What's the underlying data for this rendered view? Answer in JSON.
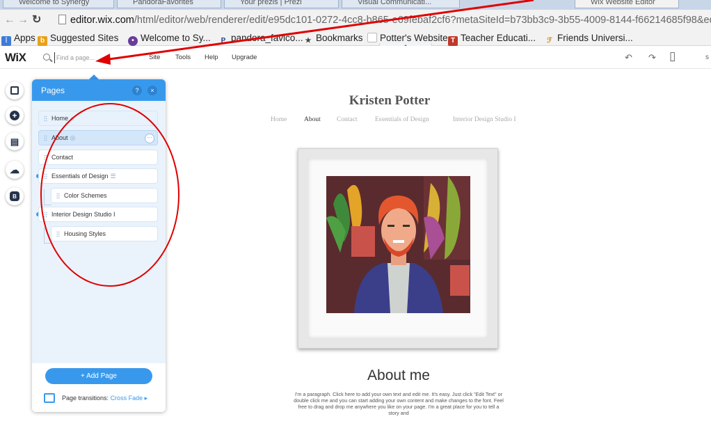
{
  "browser": {
    "tabs": [
      {
        "label": "Welcome to Synergy"
      },
      {
        "label": "PandoraFavorites"
      },
      {
        "label": "Your prezis | Prezi"
      },
      {
        "label": "Visual Communicati..."
      },
      {
        "label": "Wix Website Editor"
      }
    ],
    "url_host": "editor.wix.com",
    "url_path": "/html/editor/web/renderer/edit/e95dc101-0272-4cc8-b865-e69febaf2cf6?metaSiteId=b73bb3c9-3b55-4009-8144-f66214685f98&editorSe",
    "bookmarks": [
      {
        "label": "Apps",
        "icon": "apps-grid-icon",
        "color": "#3d7bd8"
      },
      {
        "label": "Suggested Sites",
        "icon": "suggested-sites-icon",
        "color": "#e8a11a"
      },
      {
        "label": "Welcome to Sy...",
        "icon": "synergy-icon",
        "color": "#6a3d9a"
      },
      {
        "label": "pandora_favico...",
        "icon": "pandora-icon",
        "color": "#224488"
      },
      {
        "label": "Bookmarks",
        "icon": "star-icon",
        "color": "#444444"
      },
      {
        "label": "Potter's Website",
        "icon": "document-icon",
        "color": "#bbbbbb"
      },
      {
        "label": "Teacher Educati...",
        "icon": "teacher-ed-icon",
        "color": "#c0392b"
      },
      {
        "label": "Friends Universi...",
        "icon": "friends-icon",
        "color": "#c98a12"
      }
    ],
    "collapse_glyph": "⌃"
  },
  "wix_bar": {
    "logo": "WiX",
    "search_placeholder": "Find a page...",
    "menu": [
      "Site",
      "Tools",
      "Help",
      "Upgrade"
    ],
    "tools": [
      {
        "name": "undo-icon",
        "glyph": "↶"
      },
      {
        "name": "redo-icon",
        "glyph": "↷"
      },
      {
        "name": "mobile-view-icon",
        "glyph": "▯"
      },
      {
        "name": "overflow-icon",
        "glyph": "s"
      }
    ]
  },
  "rail": [
    {
      "name": "background-button",
      "glyph": "□"
    },
    {
      "name": "add-button",
      "glyph": "+"
    },
    {
      "name": "app-market-button",
      "glyph": "▤"
    },
    {
      "name": "upload-button",
      "glyph": "☁"
    },
    {
      "name": "blog-button",
      "glyph": "B"
    }
  ],
  "pages_panel": {
    "title": "Pages",
    "help": "?",
    "close": "×",
    "pages": [
      {
        "label": "Home",
        "extra": "⌂"
      },
      {
        "label": "About",
        "extra": "◎"
      },
      {
        "label": "Contact",
        "extra": ""
      },
      {
        "label": "Essentials of Design",
        "extra": "☰"
      },
      {
        "label": "Color Schemes",
        "extra": ""
      },
      {
        "label": "Interior Design Studio I",
        "extra": ""
      },
      {
        "label": "Housing Styles",
        "extra": ""
      }
    ],
    "row_menu": "···",
    "add_page": "+ Add Page",
    "transitions_label": "Page transitions:",
    "transitions_value": "Cross Fade ▸"
  },
  "site": {
    "title": "Kristen Potter",
    "nav": [
      "Home",
      "About",
      "Contact",
      "Essentials of Design",
      "Interior Design Studio I"
    ],
    "active_nav": "About",
    "about_heading": "About me",
    "about_para": "I'm a paragraph. Click here to add your own text and edit me. It's easy. Just click \"Edit Text\" or double click me and you can start adding your own content and make changes to the font. Feel free to drag and drop me anywhere you like on your page. I'm a great place for you to tell a story and"
  },
  "colors": {
    "accent": "#3899ec",
    "annotation": "#e00000"
  }
}
